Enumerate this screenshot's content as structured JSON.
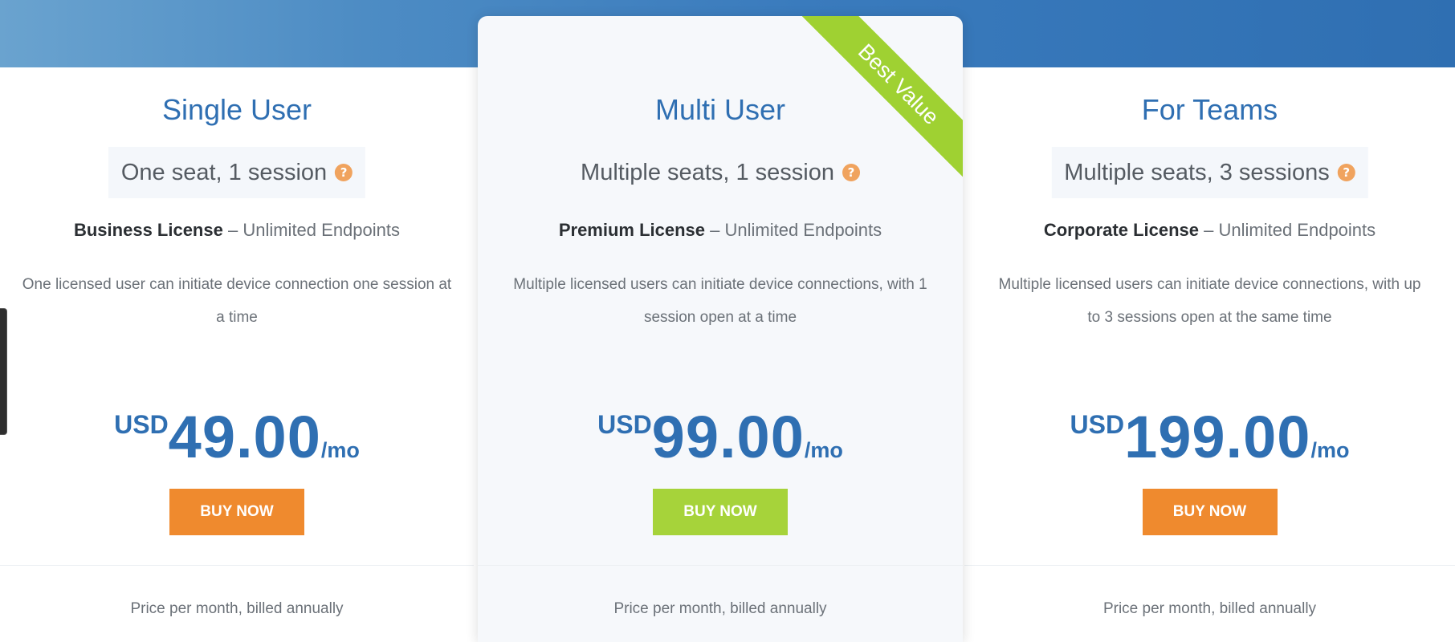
{
  "ribbon": {
    "label": "Best Value"
  },
  "plans": [
    {
      "title": "Single User",
      "seats": "One seat, 1 session",
      "license_name": "Business License",
      "license_suffix": "– Unlimited Endpoints",
      "description": "One licensed user can initiate device connection one session at a time",
      "currency": "USD",
      "amount": "49.00",
      "period": "/mo",
      "button": "BUY NOW",
      "billing": "Price per month, billed annually"
    },
    {
      "title": "Multi User",
      "seats": "Multiple seats, 1 session",
      "license_name": "Premium License",
      "license_suffix": "– Unlimited Endpoints",
      "description": "Multiple licensed users can initiate device connections, with 1 session open at a time",
      "currency": "USD",
      "amount": "99.00",
      "period": "/mo",
      "button": "BUY NOW",
      "billing": "Price per month, billed annually"
    },
    {
      "title": "For Teams",
      "seats": "Multiple seats, 3 sessions",
      "license_name": "Corporate License",
      "license_suffix": "– Unlimited Endpoints",
      "description": "Multiple licensed users can initiate device connections, with up to 3 sessions open at the same time",
      "currency": "USD",
      "amount": "199.00",
      "period": "/mo",
      "button": "BUY NOW",
      "billing": "Price per month, billed annually"
    }
  ],
  "help_icon_glyph": "?",
  "colors": {
    "accent_blue": "#2f6fb2",
    "buy_orange": "#ef8a2e",
    "buy_green": "#a6d33a",
    "ribbon_green": "#9fd132",
    "help_icon": "#f0a35e"
  }
}
